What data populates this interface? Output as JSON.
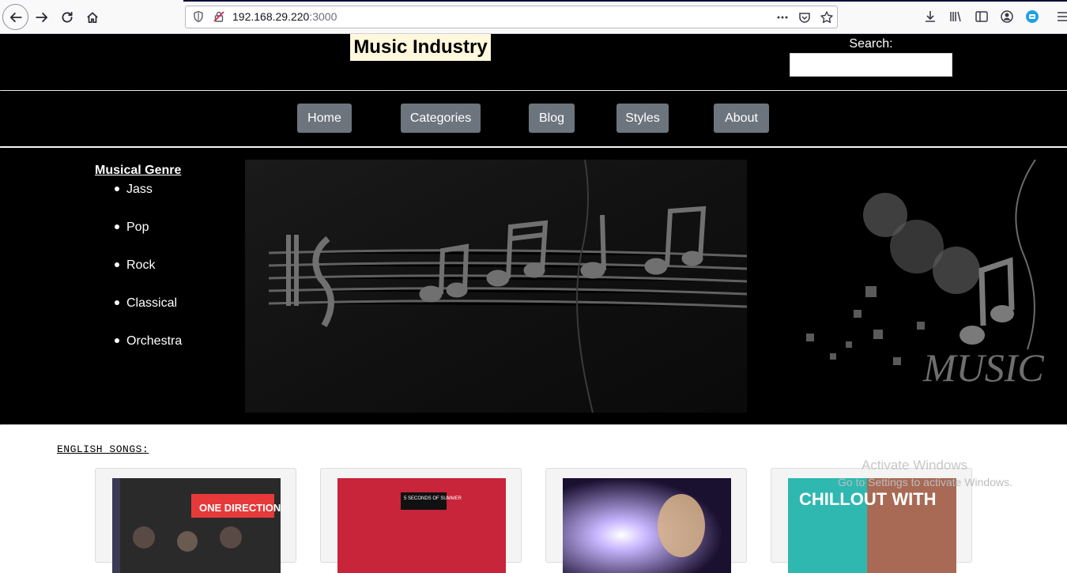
{
  "browser": {
    "url_host": "192.168.29.220",
    "url_port": ":3000"
  },
  "site": {
    "title": "Music Industry",
    "search_label": "Search:",
    "search_value": "",
    "nav": [
      {
        "label": "Home"
      },
      {
        "label": "Categories"
      },
      {
        "label": "Blog"
      },
      {
        "label": "Styles"
      },
      {
        "label": "About"
      }
    ],
    "genre_heading": "Musical Genre",
    "genres": [
      "Jass",
      "Pop",
      "Rock",
      "Classical",
      "Orchestra"
    ],
    "banner_word": "MUSIC",
    "section_title": "ENGLISH SONGS:",
    "cards": [
      {
        "thumb_text": "ONE DIRECTION",
        "accent": "#e63a3a"
      },
      {
        "thumb_text": "5 SECONDS OF SUMMER",
        "accent": "#c8243a"
      },
      {
        "thumb_text": "",
        "accent": "#4a2d6b"
      },
      {
        "thumb_text": "CHILLOUT WITH",
        "accent": "#2fb8b0"
      }
    ]
  },
  "os_watermark": {
    "line1": "Activate Windows",
    "line2": "Go to Settings to activate Windows."
  },
  "colors": {
    "nav_button": "#6c757d",
    "title_bg": "#fff8dc",
    "page_bg": "#000000"
  }
}
